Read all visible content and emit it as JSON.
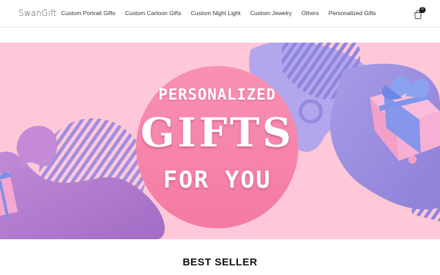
{
  "header": {
    "logo": "SwanGift",
    "nav": [
      "Custom Portrait Gifts",
      "Custom Cartoon Gifts",
      "Custom Night Light",
      "Custom Jewelry",
      "Others",
      "Personalized Gifts"
    ],
    "cart_count": "0",
    "cart_icon": "shopping-bag-icon"
  },
  "banner": {
    "line1": "PERSONALIZED",
    "line2": "GIFTS",
    "line3": "FOR YOU",
    "colors": {
      "background": "#ffc8d8",
      "circle": "#f78fb0",
      "purple": "#b07fd0",
      "lavender": "#a99ee8"
    }
  },
  "sections": {
    "best_seller": "BEST SELLER"
  }
}
